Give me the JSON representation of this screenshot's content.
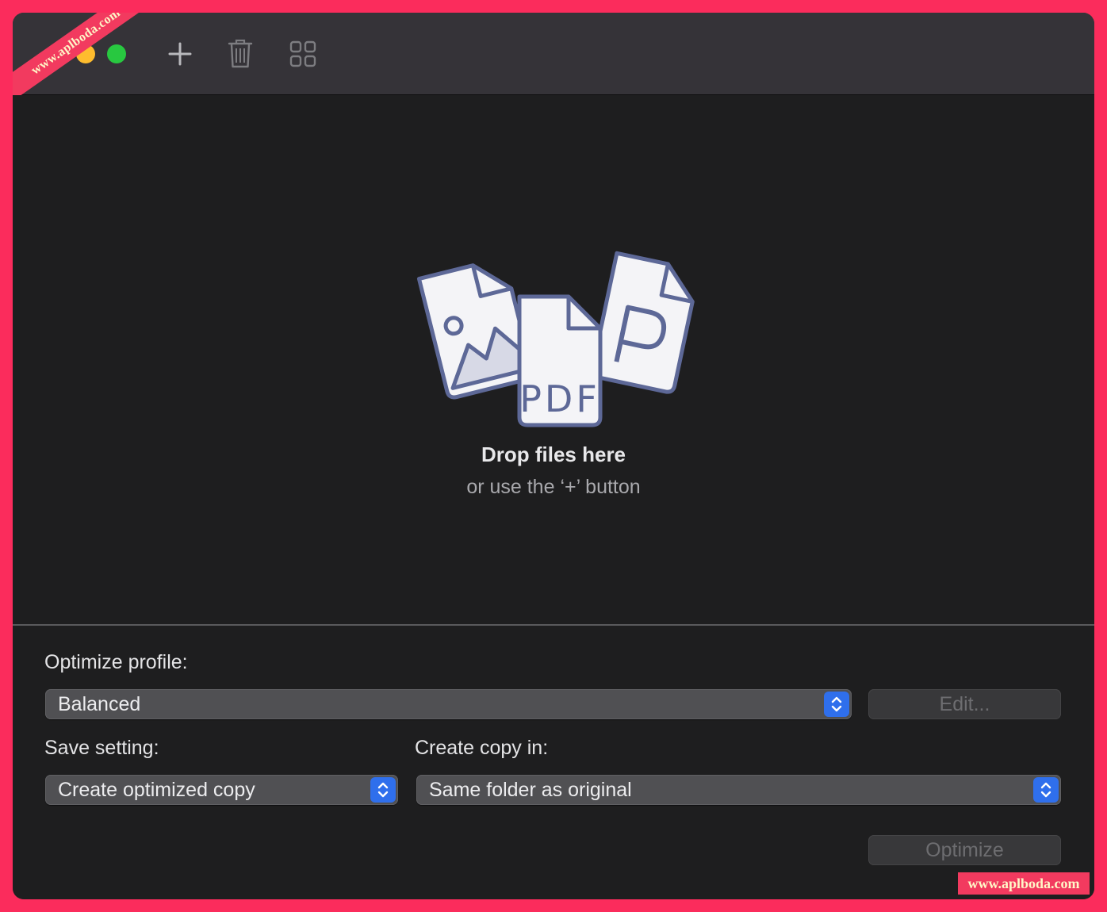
{
  "toolbar": {
    "add_icon": "plus-icon",
    "trash_icon": "trash-icon",
    "grid_icon": "grid-icon"
  },
  "dropzone": {
    "title": "Drop files here",
    "subtitle": "or use the ‘+’ button",
    "art_label": "PDF"
  },
  "settings": {
    "profile_label": "Optimize profile:",
    "profile_value": "Balanced",
    "edit_label": "Edit...",
    "save_label": "Save setting:",
    "save_value": "Create optimized copy",
    "copy_label": "Create copy in:",
    "copy_value": "Same folder as original",
    "optimize_label": "Optimize"
  },
  "watermark": {
    "top_left": "www.aplboda.com",
    "bottom_right": "www.aplboda.com"
  },
  "colors": {
    "frame": "#fb2c5c",
    "accent": "#2f6fec",
    "window_bg": "#1e1e1f",
    "titlebar_bg": "#353338"
  }
}
